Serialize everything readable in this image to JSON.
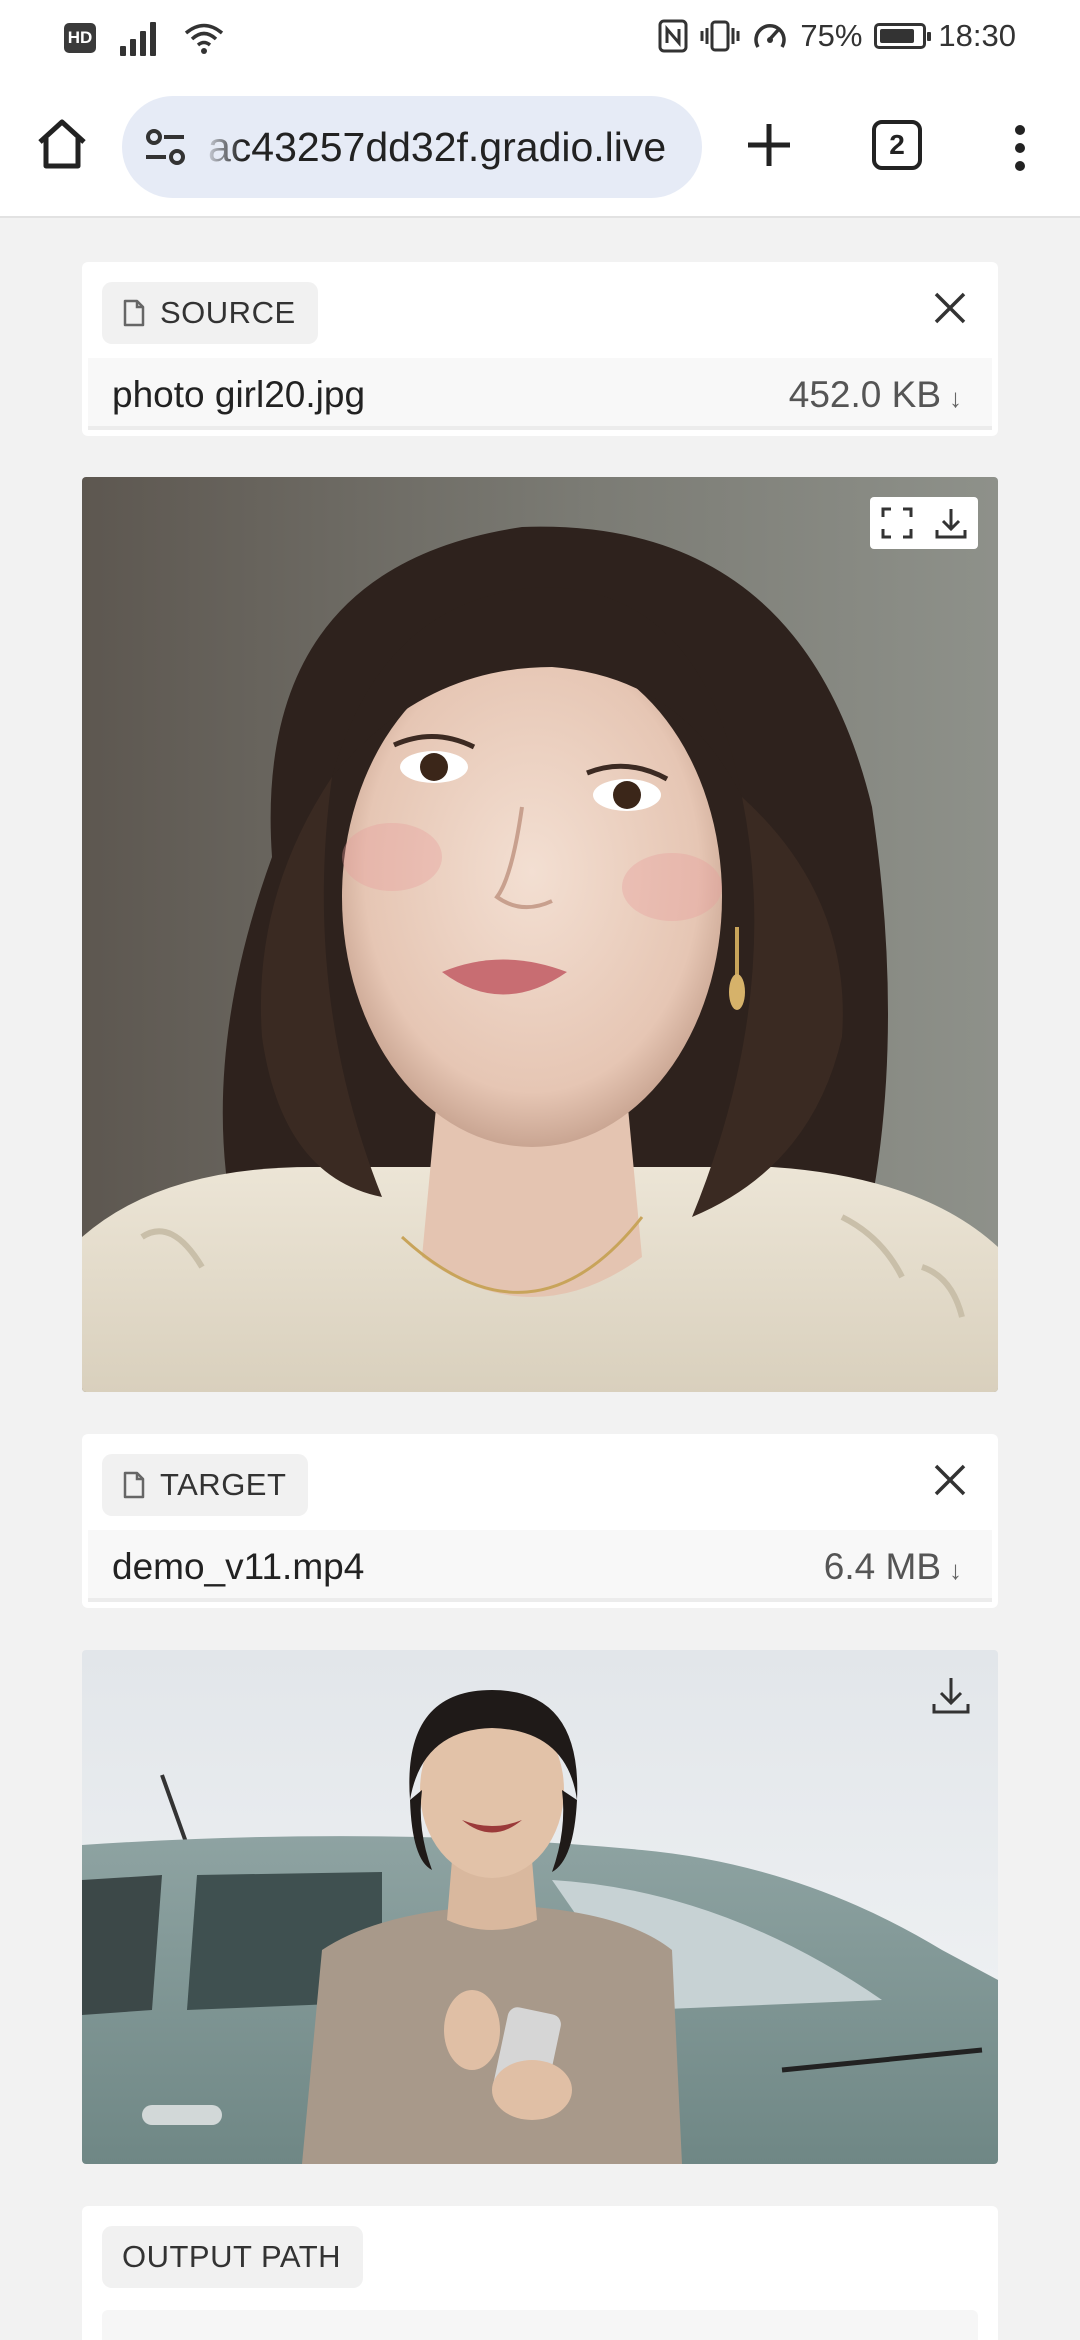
{
  "status_bar": {
    "battery": "75%",
    "time": "18:30",
    "icons": [
      "hd-icon",
      "signal-icon",
      "wifi-icon",
      "nfc-icon",
      "vibrate-icon",
      "data-saver-icon",
      "battery-icon"
    ]
  },
  "browser": {
    "url": "ac43257dd32f.gradio.live",
    "tab_count": "2",
    "icons": [
      "home-icon",
      "site-settings-icon",
      "new-tab-icon",
      "tabs-icon",
      "menu-icon"
    ]
  },
  "source": {
    "label": "SOURCE",
    "file_name": "photo girl20.jpg",
    "file_size": "452.0 KB",
    "size_arrow": "↓"
  },
  "target": {
    "label": "TARGET",
    "file_name": "demo_v11.mp4",
    "file_size": "6.4 MB",
    "size_arrow": "↓"
  },
  "output": {
    "label": "OUTPUT PATH"
  },
  "colors": {
    "page_bg": "#f2f2f2",
    "url_bar_bg": "#e6ebf6",
    "label_bg": "#f1f1f1"
  }
}
